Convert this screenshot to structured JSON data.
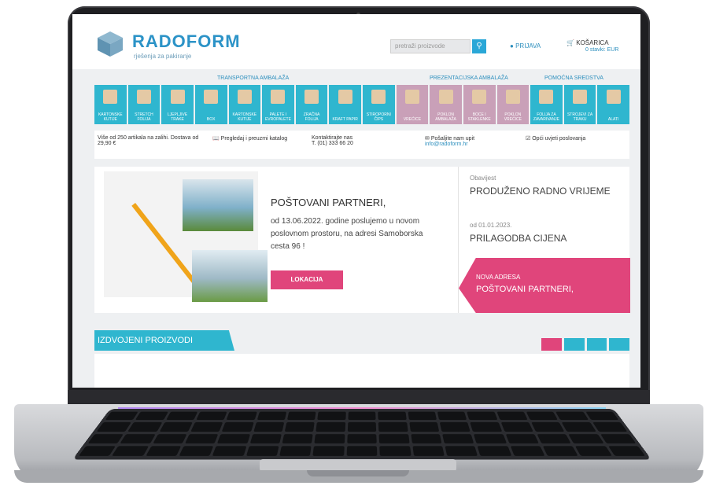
{
  "brand": {
    "name": "RADOFORM",
    "tagline": "rješenja za pakiranje"
  },
  "header": {
    "search_placeholder": "pretraži proizvode",
    "search_icon": "search-icon",
    "login_label": "PRIJAVA",
    "cart_label": "KOŠARICA",
    "cart_value": "0 stavki: EUR"
  },
  "category_groups": [
    "TRANSPORTNA AMBALAŽA",
    "PREZENTACIJSKA AMBALAŽA",
    "POMOĆNA SREDSTVA"
  ],
  "categories": [
    "KARTONSKE KUTIJE",
    "STRETCH FOLIJA",
    "LJEPLJIVE TRAKE",
    "BOX",
    "KARTONSKE KUTIJE",
    "PALETE I EVROPALETE",
    "ZRAČNA FOLIJA",
    "KRAFT PAPIR",
    "STIROPORNI ČIPS",
    "VREĆICE",
    "POKLON AMBALAŽA",
    "BOCE I STAKLENKE",
    "POKLON VREĆICE",
    "FOLIJA ZA ZAVARIVANJE",
    "STROJEVI ZA TRAKU",
    "ALATI"
  ],
  "info": {
    "stock": "Više od 250 artikala na zalihi. Dostava od 29,90 €",
    "catalog": "Pregledaj i preuzmi katalog",
    "phone_label": "Kontaktirajte nas",
    "phone": "T. (01) 333 66 20",
    "email_label": "Pošaljite nam upit",
    "email": "info@radoform.hr",
    "terms": "Opći uvjeti poslovanja"
  },
  "hero": {
    "title": "POŠTOVANI PARTNERI,",
    "text": "od 13.06.2022. godine poslujemo u novom poslovnom prostoru, na adresi Samoborska cesta 96 !",
    "button": "LOKACIJA"
  },
  "side": {
    "item1_small": "Obavijest",
    "item1_big": "PRODUŽENO RADNO VRIJEME",
    "item2_small": "od 01.01.2023.",
    "item2_big": "PRILAGODBA CIJENA",
    "pink_small": "NOVA ADRESA",
    "pink_big": "POŠTOVANI PARTNERI,"
  },
  "featured": {
    "title": "IZDVOJENI PROIZVODI"
  },
  "colors": {
    "accent": "#2fb6cf",
    "pink": "#e0457b",
    "brand_blue": "#2c93c7"
  }
}
